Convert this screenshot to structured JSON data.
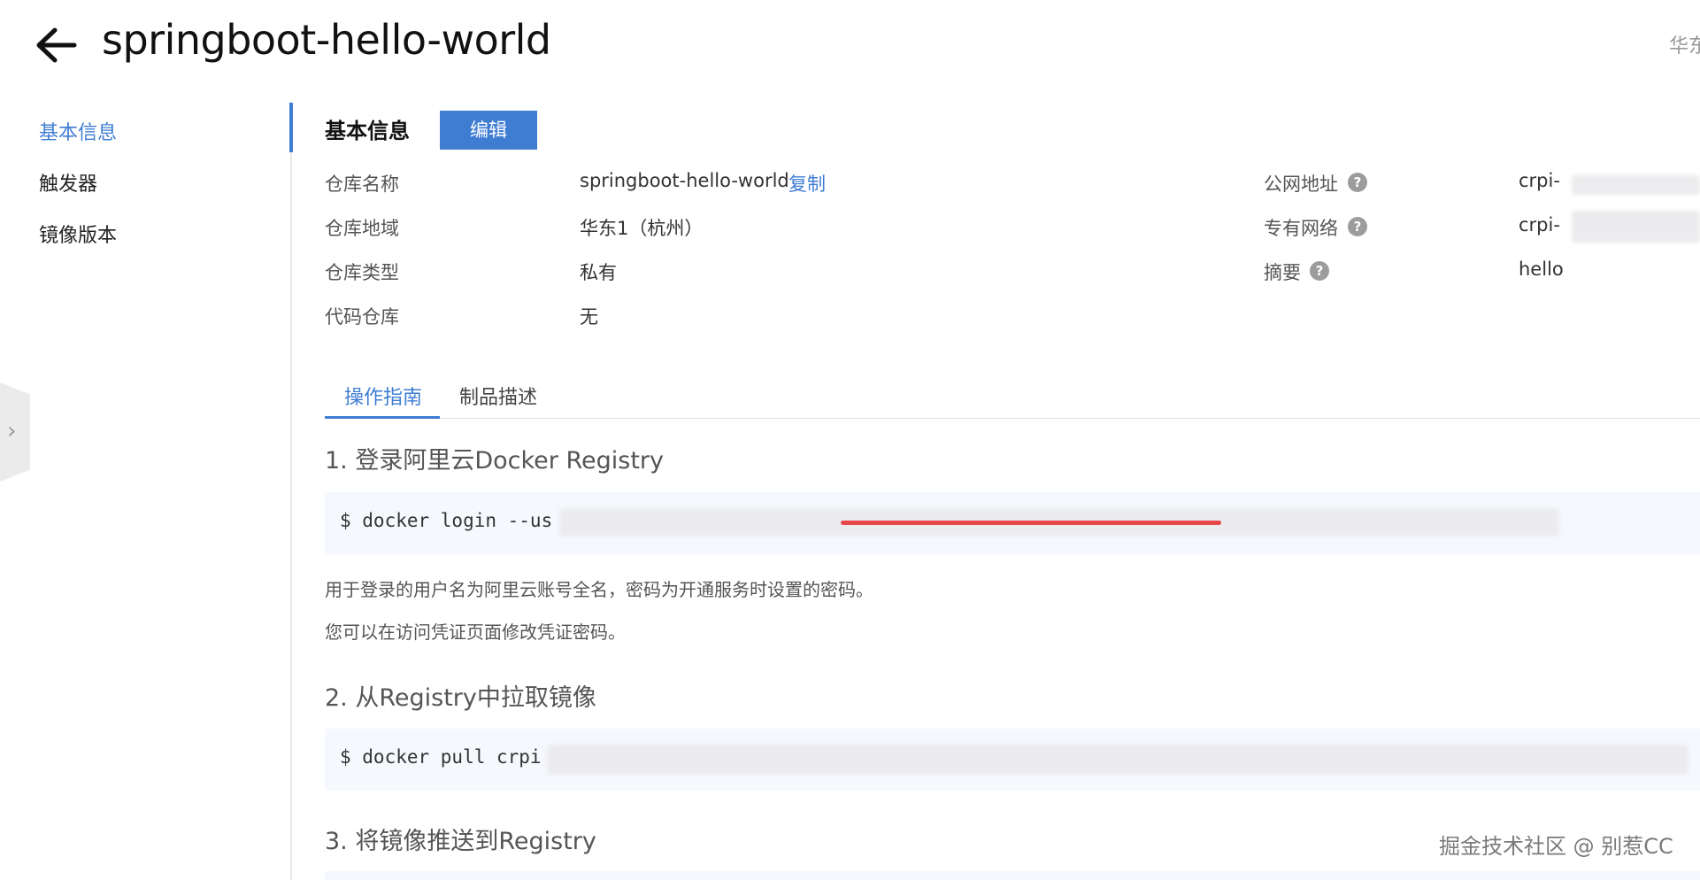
{
  "header": {
    "title": "springboot-hello-world",
    "region_partial": "华东"
  },
  "sidebar": {
    "items": [
      {
        "label": "基本信息",
        "active": true
      },
      {
        "label": "触发器",
        "active": false
      },
      {
        "label": "镜像版本",
        "active": false
      }
    ]
  },
  "basic_info": {
    "section_title": "基本信息",
    "edit_label": "编辑",
    "left_fields": [
      {
        "label": "仓库名称",
        "value": "springboot-hello-world"
      },
      {
        "label": "仓库地域",
        "value": "华东1（杭州）"
      },
      {
        "label": "仓库类型",
        "value": "私有"
      },
      {
        "label": "代码仓库",
        "value": "无"
      }
    ],
    "copy_label": "复制",
    "right_fields": [
      {
        "label": "公网地址",
        "value": "crpi-"
      },
      {
        "label": "专有网络",
        "value": "crpi-"
      },
      {
        "label": "摘要",
        "value": "hello"
      }
    ]
  },
  "tabs": [
    {
      "label": "操作指南",
      "active": true
    },
    {
      "label": "制品描述",
      "active": false
    }
  ],
  "guide": {
    "steps": [
      {
        "title": "1. 登录阿里云Docker Registry",
        "code": "$ docker login --us"
      },
      {
        "title": "2. 从Registry中拉取镜像",
        "code": "$ docker pull crpi"
      },
      {
        "title": "3. 将镜像推送到Registry",
        "code": ""
      }
    ],
    "notes": [
      "用于登录的用户名为阿里云账号全名，密码为开通服务时设置的密码。",
      "您可以在访问凭证页面修改凭证密码。"
    ]
  },
  "watermark": "掘金技术社区 @ 别惹CC",
  "colors": {
    "accent": "#3f7dd3",
    "code_bg": "#f5f8fd",
    "redline": "#e8474c"
  },
  "icons": {
    "back": "arrow-left-icon",
    "help": "question-circle-icon",
    "collapse": "chevron-right-icon"
  }
}
